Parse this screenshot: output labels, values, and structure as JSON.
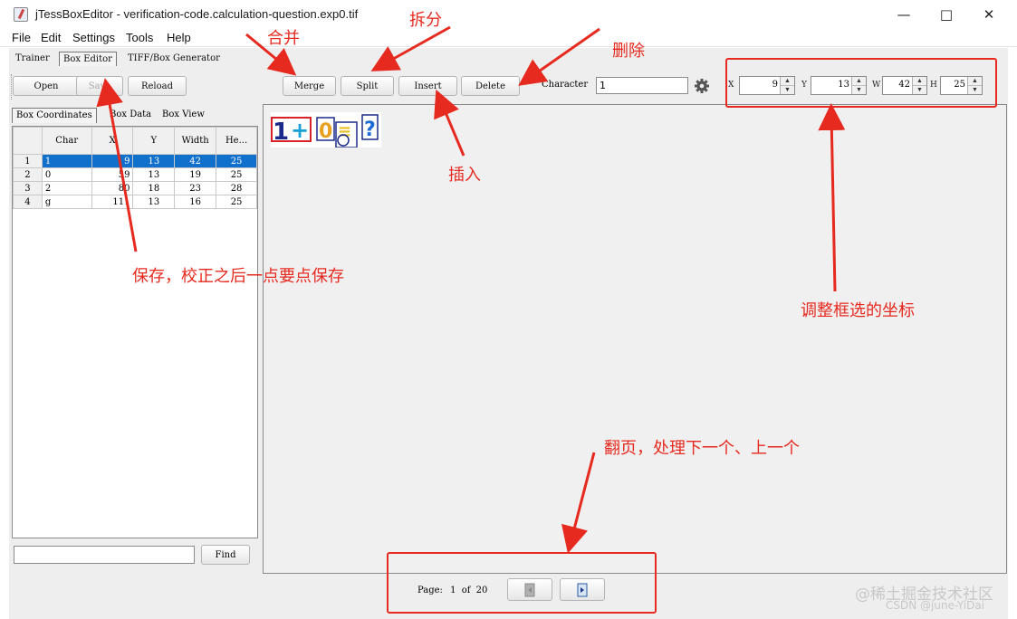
{
  "window": {
    "title": "jTessBoxEditor - verification-code.calculation-question.exp0.tif",
    "controls": [
      "—",
      "□",
      "✕"
    ]
  },
  "menu": [
    "File",
    "Edit",
    "Settings",
    "Tools",
    "Help"
  ],
  "main_tabs": [
    "Trainer",
    "Box Editor",
    "TIFF/Box Generator"
  ],
  "toolbar": {
    "open": "Open",
    "save": "Save",
    "reload": "Reload",
    "merge": "Merge",
    "split": "Split",
    "insert": "Insert",
    "delete": "Delete",
    "character_label": "Character",
    "character_value": "1",
    "settings_icon": "gear-icon"
  },
  "coords": {
    "x_label": "X",
    "x": "9",
    "y_label": "Y",
    "y": "13",
    "w_label": "W",
    "w": "42",
    "h_label": "H",
    "h": "25"
  },
  "left_tabs": [
    "Box Coordinates",
    "Box Data",
    "Box View"
  ],
  "table": {
    "headers": [
      "",
      "Char",
      "X",
      "Y",
      "Width",
      "He..."
    ],
    "rows": [
      [
        "1",
        "1",
        "9",
        "13",
        "42",
        "25"
      ],
      [
        "2",
        "0",
        "59",
        "13",
        "19",
        "25"
      ],
      [
        "3",
        "2",
        "80",
        "18",
        "23",
        "28"
      ],
      [
        "4",
        "g",
        "111",
        "13",
        "16",
        "25"
      ]
    ]
  },
  "find": {
    "value": "",
    "button": "Find"
  },
  "paging": {
    "label": "Page:",
    "current": "1",
    "of": "of",
    "total": "20"
  },
  "annotations": {
    "merge": "合并",
    "split": "拆分",
    "delete": "删除",
    "insert": "插入",
    "save": "保存，校正之后一点要点保存",
    "coords": "调整框选的坐标",
    "paging": "翻页，处理下一个、上一个"
  },
  "watermark": {
    "line1": "@稀土掘金技术社区",
    "line2": "CSDN @june-YiDai"
  },
  "colors": {
    "annotation": "#e62a1f",
    "selection": "#1070cc"
  }
}
